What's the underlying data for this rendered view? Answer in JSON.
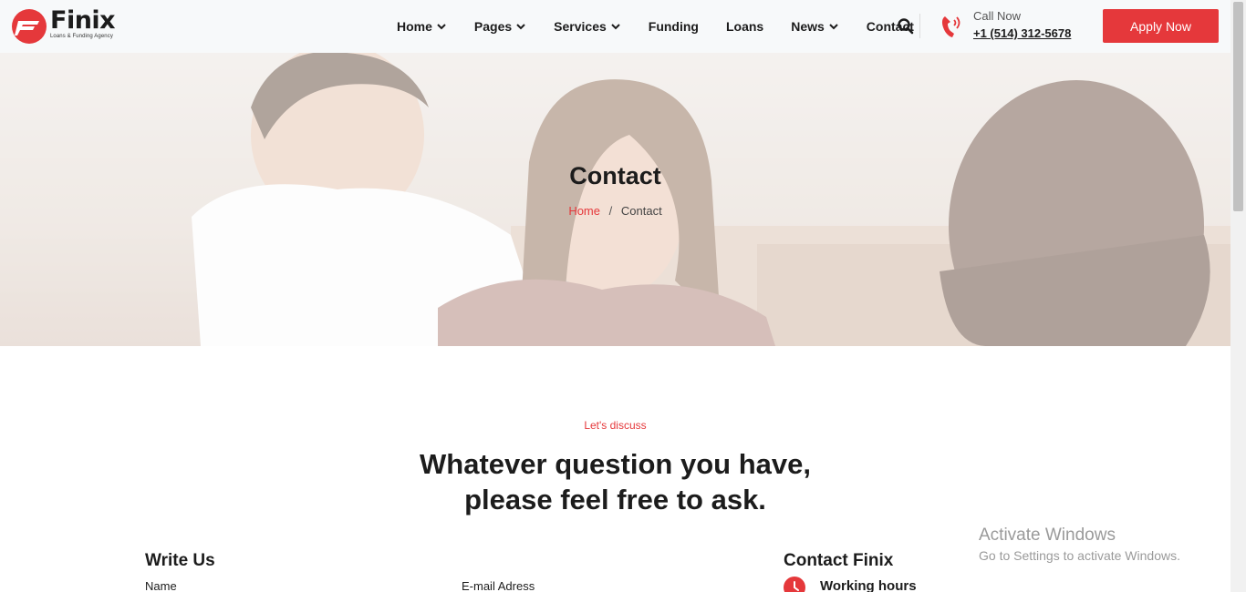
{
  "header": {
    "logo_name": "Finix",
    "logo_tagline": "Loans & Funding Agency",
    "nav": [
      {
        "label": "Home",
        "dropdown": true
      },
      {
        "label": "Pages",
        "dropdown": true
      },
      {
        "label": "Services",
        "dropdown": true
      },
      {
        "label": "Funding",
        "dropdown": false
      },
      {
        "label": "Loans",
        "dropdown": false
      },
      {
        "label": "News",
        "dropdown": true
      },
      {
        "label": "Contact",
        "dropdown": false
      }
    ],
    "call_label": "Call Now",
    "call_number": "+1 (514) 312-5678",
    "apply_label": "Apply Now"
  },
  "hero": {
    "title": "Contact",
    "breadcrumb_home": "Home",
    "breadcrumb_separator": "/",
    "breadcrumb_current": "Contact"
  },
  "content": {
    "eyebrow": "Let's discuss",
    "heading_line1": "Whatever question you have,",
    "heading_line2": "please feel free to ask.",
    "form_title": "Write Us",
    "name_label": "Name",
    "email_label": "E-mail Adress",
    "contact_title": "Contact Finix",
    "working_hours_label": "Working hours"
  },
  "watermark": {
    "title": "Activate Windows",
    "subtitle": "Go to Settings to activate Windows."
  },
  "colors": {
    "accent": "#e5383b",
    "text": "#1c1c1c",
    "header_bg": "#f7f9fa"
  },
  "icons": [
    "logo-icon",
    "chevron-down-icon",
    "search-icon",
    "phone-icon",
    "clock-icon"
  ]
}
